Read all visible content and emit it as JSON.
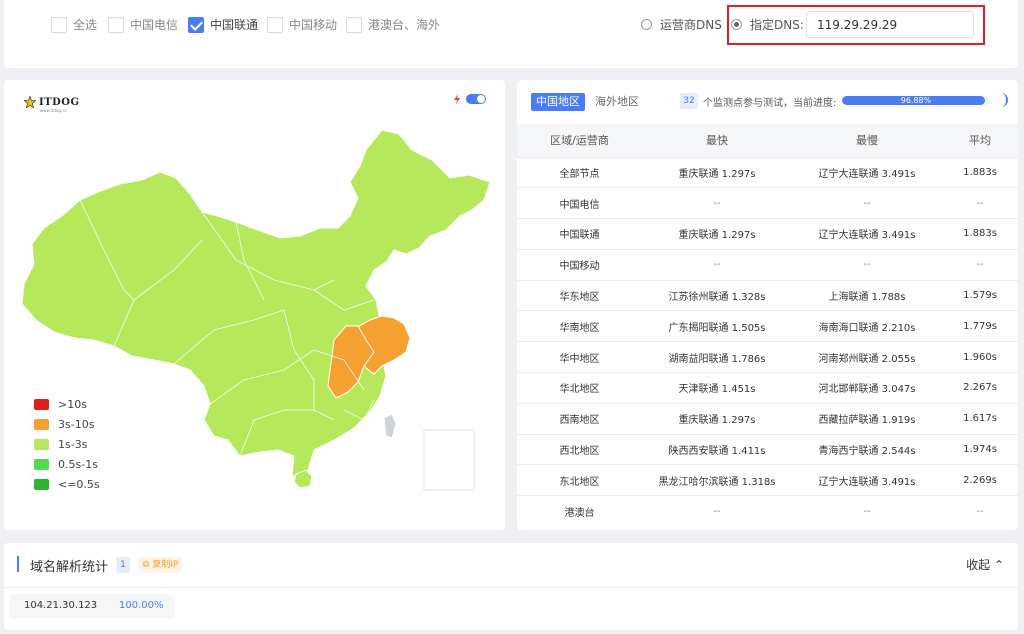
{
  "filters": {
    "options": [
      {
        "label": "全选",
        "checked": false
      },
      {
        "label": "中国电信",
        "checked": false
      },
      {
        "label": "中国联通",
        "checked": true
      },
      {
        "label": "中国移动",
        "checked": false
      },
      {
        "label": "港澳台、海外",
        "checked": false
      }
    ],
    "dns_mode": {
      "isp_label": "运营商DNS",
      "custom_label": "指定DNS:",
      "selected": "custom",
      "custom_value": "119.29.29.29"
    }
  },
  "map": {
    "logo_text": "ITDOG",
    "logo_sub": "www.itdog.cn",
    "toggle_on": true,
    "legend": [
      {
        "label": ">10s",
        "color": "#e01e1e"
      },
      {
        "label": "3s-10s",
        "color": "#f5a031"
      },
      {
        "label": "1s-3s",
        "color": "#b5e85a"
      },
      {
        "label": "0.5s-1s",
        "color": "#4fdc4f"
      },
      {
        "label": "<=0.5s",
        "color": "#2db52d"
      }
    ]
  },
  "results": {
    "tab_china": "中国地区",
    "tab_overseas": "海外地区",
    "node_count": "32",
    "progress_label": "个监测点参与测试，当前进度:",
    "progress_value": 96.88,
    "progress_text": "96.88%",
    "columns": [
      "区域/运营商",
      "最快",
      "最慢",
      "平均"
    ],
    "rows": [
      [
        "全部节点",
        "重庆联通 1.297s",
        "辽宁大连联通 3.491s",
        "1.883s"
      ],
      [
        "中国电信",
        "--",
        "--",
        "--"
      ],
      [
        "中国联通",
        "重庆联通 1.297s",
        "辽宁大连联通 3.491s",
        "1.883s"
      ],
      [
        "中国移动",
        "--",
        "--",
        "--"
      ],
      [
        "华东地区",
        "江苏徐州联通 1.328s",
        "上海联通 1.788s",
        "1.579s"
      ],
      [
        "华南地区",
        "广东揭阳联通 1.505s",
        "海南海口联通 2.210s",
        "1.779s"
      ],
      [
        "华中地区",
        "湖南益阳联通 1.786s",
        "河南郑州联通 2.055s",
        "1.960s"
      ],
      [
        "华北地区",
        "天津联通 1.451s",
        "河北邯郸联通 3.047s",
        "2.267s"
      ],
      [
        "西南地区",
        "重庆联通 1.297s",
        "西藏拉萨联通 1.919s",
        "1.617s"
      ],
      [
        "西北地区",
        "陕西西安联通 1.411s",
        "青海西宁联通 2.544s",
        "1.974s"
      ],
      [
        "东北地区",
        "黑龙江哈尔滨联通 1.318s",
        "辽宁大连联通 3.491s",
        "2.269s"
      ],
      [
        "港澳台",
        "--",
        "--",
        "--"
      ]
    ]
  },
  "domain_stats": {
    "title": "域名解析统计",
    "count": "1",
    "copy_label": "复制IP",
    "collapse_label": "收起",
    "ip": "104.21.30.123",
    "percent": "100.00%"
  }
}
